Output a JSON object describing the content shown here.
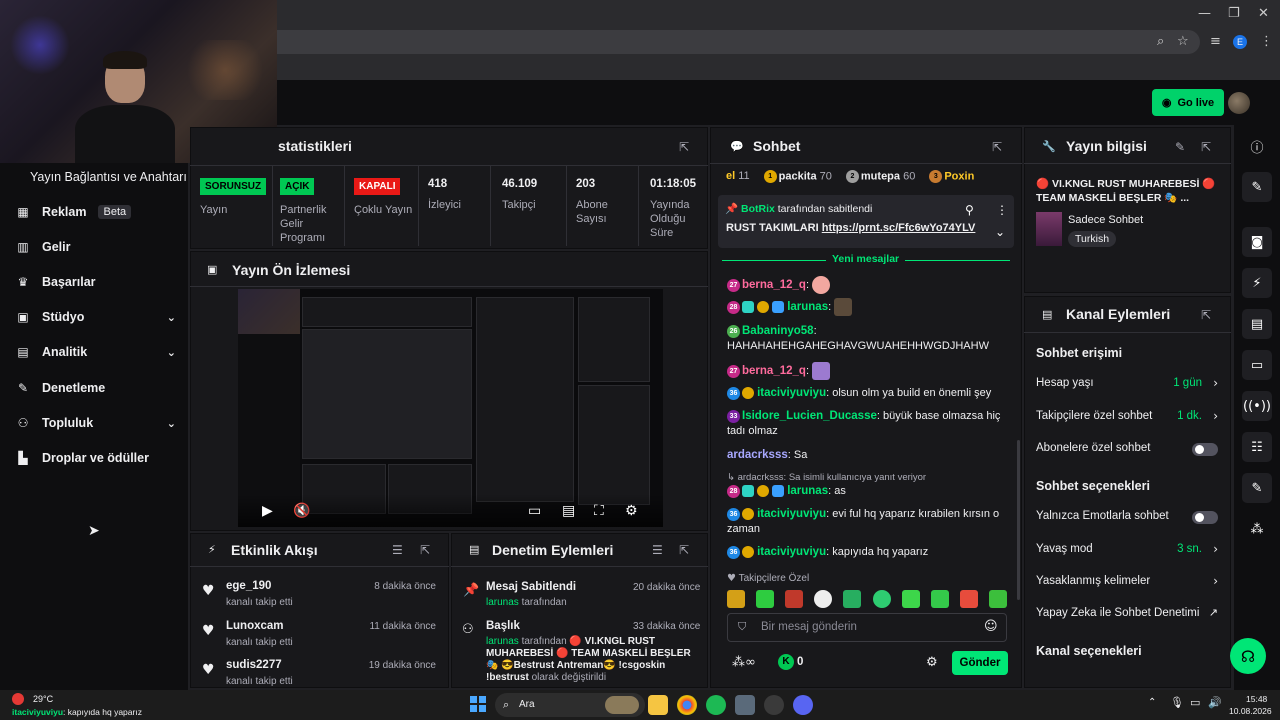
{
  "browser": {
    "controls": [
      "—",
      "❐",
      "✕"
    ],
    "profile_letter": "E"
  },
  "topnav": {
    "golive_label": "Go live"
  },
  "sidebar": {
    "title": "Yayın Bağlantısı ve Anahtarı",
    "items": [
      {
        "label": "Reklam",
        "badge": "Beta",
        "icon": "▦"
      },
      {
        "label": "Gelir",
        "icon": "▥"
      },
      {
        "label": "Başarılar",
        "icon": "🏆"
      },
      {
        "label": "Stüdyo",
        "icon": "▣",
        "expand": true
      },
      {
        "label": "Analitik",
        "icon": "▤",
        "expand": true
      },
      {
        "label": "Denetleme",
        "icon": "🔧"
      },
      {
        "label": "Topluluk",
        "icon": "👥",
        "expand": true
      },
      {
        "label": "Droplar ve ödüller",
        "icon": "▙"
      }
    ]
  },
  "stats": {
    "title": "statistikleri",
    "items": [
      {
        "tag": "SORUNSUZ",
        "label": "Yayın",
        "tag_color": "#00c853"
      },
      {
        "tag": "AÇIK",
        "label": "Partnerlik Gelir Programı",
        "tag_color": "#00c853"
      },
      {
        "tag": "KAPALI",
        "label": "Çoklu Yayın",
        "tag_color": "#e91916"
      },
      {
        "value": "418",
        "label": "İzleyici"
      },
      {
        "value": "46.109",
        "label": "Takipçi"
      },
      {
        "value": "203",
        "label": "Abone Sayısı"
      },
      {
        "value": "01:18:05",
        "label": "Yayında Olduğu Süre"
      }
    ]
  },
  "preview": {
    "title": "Yayın Ön İzlemesi"
  },
  "activity": {
    "title": "Etkinlik Akışı",
    "items": [
      {
        "user": "ege_190",
        "action": "kanalı takip etti",
        "time": "8 dakika önce"
      },
      {
        "user": "Lunoxcam",
        "action": "kanalı takip etti",
        "time": "11 dakika önce"
      },
      {
        "user": "sudis2277",
        "action": "kanalı takip etti",
        "time": "19 dakika önce"
      }
    ]
  },
  "moderation": {
    "title": "Denetim Eylemleri",
    "items": [
      {
        "title": "Mesaj Sabitlendi",
        "user": "larunas",
        "suffix": "tarafından",
        "time": "20 dakika önce"
      },
      {
        "title": "Başlık",
        "user": "larunas",
        "suffix": "tarafından",
        "detail": "🔴 VI.KNGL RUST MUHAREBESİ 🔴 TEAM MASKELİ BEŞLER 🎭 😎Bestrust Antreman😎 !csgoskin !bestrust",
        "tail": "olarak değiştirildi",
        "time": "33 dakika önce"
      }
    ]
  },
  "chat": {
    "title": "Sohbet",
    "leaderboard": [
      {
        "prefix": "el",
        "count": "11"
      },
      {
        "rank": "1",
        "name": "packita",
        "count": "70"
      },
      {
        "rank": "2",
        "name": "mutepa",
        "count": "60"
      },
      {
        "rank": "3",
        "name": "Poxin",
        "count": ""
      }
    ],
    "pinned": {
      "by": "BotRix",
      "by_suffix": "tarafından sabitlendi",
      "text": "RUST TAKIMLARI",
      "link": "https://prnt.sc/Ffc6wYo74YLV"
    },
    "new_messages": "Yeni mesajlar",
    "messages": [
      {
        "badge": "27",
        "user": "berna_12_q",
        "text": "",
        "color": "#ff6b9d"
      },
      {
        "badge": "28",
        "user": "larunas",
        "text": "",
        "color": "#00e676"
      },
      {
        "badge": "26",
        "user": "Babaninyo58",
        "text": "HAHAHAHEHGAHEGHAVGWUAHEHHWGDJHAHW",
        "color": "#00e676"
      },
      {
        "badge": "27",
        "user": "berna_12_q",
        "text": "",
        "color": "#ff6b9d"
      },
      {
        "badge": "36",
        "user": "itaciviyuviyu",
        "text": "olsun olm ya build en önemli şey",
        "color": "#00e676"
      },
      {
        "badge": "33",
        "user": "Isidore_Lucien_Ducasse",
        "text": "büyük base olmazsa hiç tadı olmaz",
        "color": "#00e676"
      },
      {
        "user": "ardacrksss",
        "text": "Sa",
        "color": "#a8a8ff"
      },
      {
        "reply": "ardacrksss: Sa isimli kullanıcıya yanıt veriyor"
      },
      {
        "badge": "28",
        "user": "larunas",
        "text": "as",
        "color": "#00e676"
      },
      {
        "badge": "36",
        "user": "itaciviyuviyu",
        "text": "evi ful hq yaparız kırabilen kırsın o zaman",
        "color": "#00e676"
      },
      {
        "badge": "36",
        "user": "itaciviyuviyu",
        "text": "kapıyıda hq yaparız",
        "color": "#00e676"
      }
    ],
    "followers_only": "Takipçilere Özel",
    "input_placeholder": "Bir mesaj gönderin",
    "points": "0",
    "send": "Gönder"
  },
  "stream_info": {
    "title": "Yayın bilgisi",
    "stream_title": "🔴 VI.KNGL RUST MUHAREBESİ 🔴 TEAM MASKELİ BEŞLER 🎭 ...",
    "category": "Sadece Sohbet",
    "language": "Turkish"
  },
  "channel_actions": {
    "title": "Kanal Eylemleri",
    "chat_access": "Sohbet erişimi",
    "access_rows": [
      {
        "label": "Hesap yaşı",
        "value": "1 gün"
      },
      {
        "label": "Takipçilere özel sohbet",
        "value": "1 dk."
      },
      {
        "label": "Abonelere özel sohbet",
        "toggle": true
      }
    ],
    "chat_options": "Sohbet seçenekleri",
    "option_rows": [
      {
        "label": "Yalnızca Emotlarla sohbet",
        "toggle": true
      },
      {
        "label": "Yavaş mod",
        "value": "3 sn."
      },
      {
        "label": "Yasaklanmış kelimeler"
      },
      {
        "label": "Yapay Zeka ile Sohbet Denetimi"
      }
    ],
    "channel_options": "Kanal seçenekleri"
  },
  "taskbar": {
    "weather": "29°C",
    "notice_user": "itaciviyuviyu",
    "notice_text": ": kapıyıda hq yaparız",
    "search": "Ara",
    "time": "15:48",
    "date": "10.08.2026"
  }
}
